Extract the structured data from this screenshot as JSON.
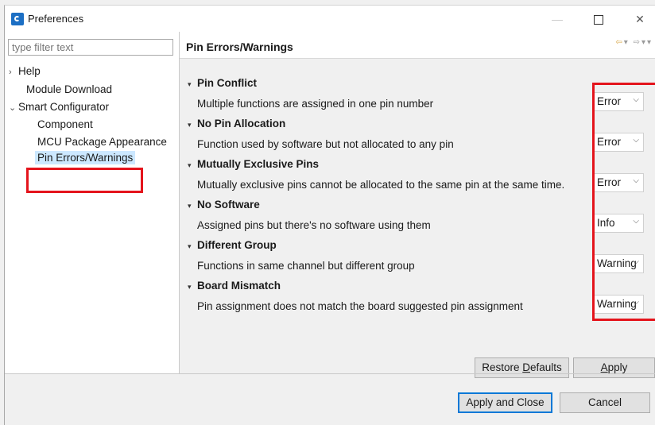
{
  "window": {
    "title": "Preferences"
  },
  "filter": {
    "placeholder": "type filter text"
  },
  "tree": [
    {
      "label": "Help",
      "twisty": ">"
    },
    {
      "label": "Module Download"
    },
    {
      "label": "Smart Configurator",
      "twisty": "v"
    },
    {
      "label": "Component"
    },
    {
      "label": "MCU Package Appearance"
    },
    {
      "label": "Pin Errors/Warnings",
      "selected": true
    }
  ],
  "page": {
    "title": "Pin Errors/Warnings"
  },
  "sections": [
    {
      "title": "Pin Conflict",
      "description": "Multiple functions are assigned in one pin number",
      "value": "Error"
    },
    {
      "title": "No Pin Allocation",
      "description": "Function used by software but not allocated to any pin",
      "value": "Error"
    },
    {
      "title": "Mutually Exclusive Pins",
      "description": "Mutually exclusive pins cannot be allocated to the same pin at the same time.",
      "value": "Error"
    },
    {
      "title": "No Software",
      "description": "Assigned pins but there's no software using them",
      "value": "Info"
    },
    {
      "title": "Different Group",
      "description": "Functions in same channel but different group",
      "value": "Warning"
    },
    {
      "title": "Board Mismatch",
      "description": "Pin assignment does not match the board suggested pin assignment",
      "value": "Warning"
    }
  ],
  "buttons": {
    "restore_defaults_pre": "Restore ",
    "restore_defaults_ul": "D",
    "restore_defaults_post": "efaults",
    "apply_ul": "A",
    "apply_post": "pply",
    "apply_and_close": "Apply and Close",
    "cancel": "Cancel"
  },
  "colors": {
    "highlight_border": "#e4141c",
    "selection": "#cce8ff",
    "primary_border": "#0078d7"
  }
}
